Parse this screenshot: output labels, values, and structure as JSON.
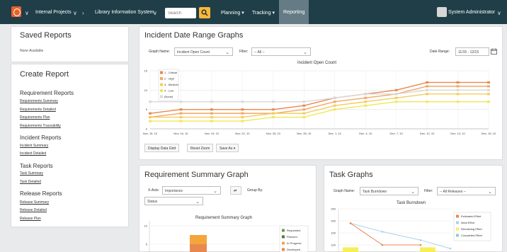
{
  "topnav": {
    "project": "Internal Projects",
    "system": "Library Information System",
    "search_placeholder": "Search",
    "planning": "Planning ▾",
    "tracking": "Tracking ▾",
    "reporting": "Reporting",
    "user": "System Administrator"
  },
  "sidebar": {
    "saved_title": "Saved Reports",
    "saved_none": "None Available",
    "create_title": "Create Report",
    "requirement_title": "Requirement Reports",
    "requirement_links": [
      "Requirements Summary",
      "Requirements Detailed",
      "Requirements Plan",
      "Requirements Traceability"
    ],
    "incident_title": "Incident Reports",
    "incident_links": [
      "Incident Summary",
      "Incident Detailed"
    ],
    "task_title": "Task Reports",
    "task_links": [
      "Task Summary",
      "Task Detailed"
    ],
    "release_title": "Release Reports",
    "release_links": [
      "Release Summary",
      "Release Detailed",
      "Release Plan"
    ]
  },
  "incident": {
    "title": "Incident Date Range Graphs",
    "graph_name_label": "Graph Name:",
    "graph_name_value": "Incident Open Count",
    "filter_label": "Filter:",
    "filter_value": "-- All --",
    "date_range_label": "Date Range:",
    "date_range_value": "11/15 - 12/15",
    "btn_display_data_grid": "Display Data Grid",
    "btn_reset_zoom": "Reset Zoom",
    "btn_save_as": "Save As ▾"
  },
  "requirement": {
    "title": "Requirement Summary Graph",
    "xaxis_label": "X-Axis:",
    "xaxis_value": "Importance",
    "groupby_label": "Group By:",
    "groupby_value": "Status",
    "chart_title": "Requirement Summary Graph"
  },
  "task": {
    "title": "Task Graphs",
    "graph_name_label": "Graph Name:",
    "graph_name_value": "Task Burndown",
    "filter_label": "Filter:",
    "filter_value": "-- All Releases --",
    "chart_title": "Task Burndown"
  },
  "colors": {
    "nav_bg": "#1f3e48",
    "critical": "#e8884f",
    "high": "#f2a766",
    "medium": "#f4cd5d",
    "low": "#eee85a",
    "none": "#d9d9d9",
    "requested": "#6a9a48",
    "planned": "#4e7a3b",
    "in_progress": "#f3a63c",
    "developed": "#e8884f"
  },
  "chart_data": [
    {
      "type": "line",
      "title": "Incident Open Count",
      "x": [
        "Nov. 15, 10",
        "Nov. 16, 10",
        "Nov. 19, 10",
        "Nov. 22, 10",
        "Nov. 25, 10",
        "Nov. 28, 10",
        "Dec. 1, 10",
        "Dec. 4, 10",
        "Dec. 7, 10",
        "Dec. 10, 10",
        "Dec. 13, 10",
        "Dec. 15, 10"
      ],
      "yticks": [
        0,
        5,
        10,
        15
      ],
      "ylim": [
        0,
        15
      ],
      "legend": "top-left",
      "series": [
        {
          "name": "1 - Critical",
          "values": [
            4,
            5,
            5,
            5,
            5,
            6,
            8,
            9,
            10,
            12,
            12,
            12
          ]
        },
        {
          "name": "2 - High",
          "values": [
            3,
            4,
            4,
            4,
            4,
            5,
            7,
            8,
            9,
            11,
            11,
            11
          ]
        },
        {
          "name": "3 - Medium",
          "values": [
            3,
            3,
            3,
            3,
            4,
            4,
            6,
            7,
            8,
            9,
            9,
            9
          ]
        },
        {
          "name": "4 - Low",
          "values": [
            2,
            2,
            2,
            2,
            3,
            3,
            5,
            6,
            7,
            7,
            7,
            7
          ]
        },
        {
          "name": "(None)",
          "values": [
            7,
            7,
            7,
            7,
            7,
            7,
            8,
            9,
            9,
            10,
            10,
            10
          ]
        }
      ]
    },
    {
      "type": "bar",
      "title": "Requirement Summary Graph",
      "yticks": [
        10,
        5
      ],
      "legend": "top-right",
      "series": [
        {
          "name": "Requested"
        },
        {
          "name": "Planned"
        },
        {
          "name": "In Progress"
        },
        {
          "name": "Developed"
        }
      ]
    },
    {
      "type": "line",
      "title": "Task Burndown",
      "yticks": [
        250,
        200,
        150,
        100
      ],
      "legend": "right",
      "series": [
        {
          "name": "Estimated Effort",
          "values": [
            190,
            100,
            100
          ]
        },
        {
          "name": "Ideal Effort",
          "values": [
            190,
            155,
            120,
            85
          ]
        },
        {
          "name": "Remaining Effort",
          "values": [
            90,
            90,
            90
          ]
        },
        {
          "name": "Completed Effort",
          "values": [
            0,
            0,
            0
          ]
        }
      ]
    }
  ]
}
